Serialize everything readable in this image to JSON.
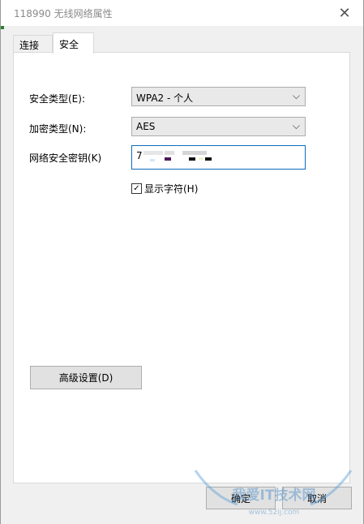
{
  "window": {
    "title": "118990 无线网络属性",
    "close_glyph": "✕"
  },
  "tabs": [
    {
      "label": "连接",
      "active": false
    },
    {
      "label": "安全",
      "active": true
    }
  ],
  "form": {
    "security_type_label": "安全类型(E):",
    "security_type_value": "WPA2 - 个人",
    "encryption_type_label": "加密类型(N):",
    "encryption_type_value": "AES",
    "key_label": "网络安全密钥(K)",
    "key_value_visible": "7",
    "show_chars_label": "显示字符(H)",
    "show_chars_checked": true
  },
  "advanced_button": "高级设置(D)",
  "footer": {
    "ok_label": "确定",
    "cancel_label": "取消"
  },
  "watermark": {
    "text": "我爱IT技术网",
    "url": "www.52ij.com"
  },
  "icons": {
    "dropdown": "chevron-down-icon",
    "close": "close-icon",
    "check": "checkmark-icon"
  },
  "colors": {
    "key_border": "#0f6cbd",
    "panel_bg": "#ffffff",
    "window_bg": "#f0f0f0"
  }
}
